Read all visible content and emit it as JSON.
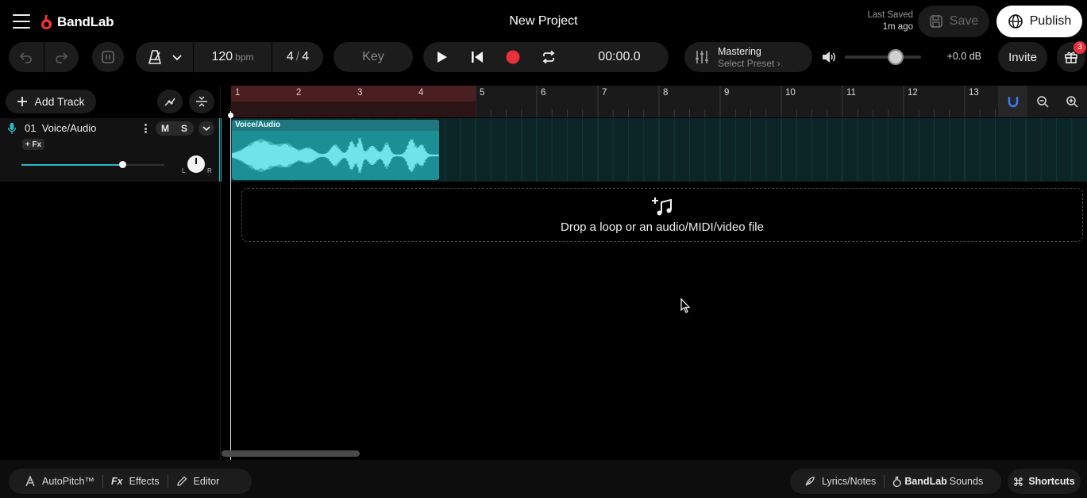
{
  "app": {
    "brand": "BandLab",
    "project_title": "New Project",
    "last_saved_label": "Last Saved",
    "last_saved_ago": "1m ago",
    "save_label": "Save",
    "publish_label": "Publish"
  },
  "toolbar": {
    "bpm_value": "120",
    "bpm_unit": "bpm",
    "time_sig_num": "4",
    "time_sig_den": "4",
    "key_label": "Key",
    "timecode": "00:00.0",
    "mastering_title": "Mastering",
    "mastering_preset": "Select Preset",
    "db_readout": "+0.0 dB",
    "master_volume_fraction": 0.67,
    "invite_label": "Invite",
    "gift_badge_count": "3"
  },
  "tracks_panel": {
    "add_track_label": "Add Track",
    "tracks": [
      {
        "number": "01",
        "name": "Voice/Audio",
        "mute_label": "M",
        "solo_label": "S",
        "fx_label": "+ Fx",
        "pan_left_label": "L",
        "pan_right_label": "R",
        "volume_fraction": 0.71,
        "color": "#2bb8c4"
      }
    ]
  },
  "timeline": {
    "bars": [
      "1",
      "2",
      "3",
      "4",
      "5",
      "6",
      "7",
      "8",
      "9",
      "10",
      "11",
      "12",
      "13"
    ],
    "loop_start_bar": 1,
    "loop_end_bar": 5,
    "clips": [
      {
        "label": "Voice/Audio",
        "track": 1
      }
    ],
    "drop_zone_text": "Drop a loop or an audio/MIDI/video file"
  },
  "bottom_bar": {
    "autopitch_label": "AutoPitch™",
    "effects_prefix": "Fx",
    "effects_label": "Effects",
    "editor_label": "Editor",
    "lyrics_label": "Lyrics/Notes",
    "sounds_brand": "BandLab",
    "sounds_label": "Sounds",
    "shortcuts_label": "Shortcuts"
  },
  "icons": {
    "menu": "hamburger-icon",
    "logo": "bandlab-logo-icon",
    "save": "save-icon",
    "publish": "globe-icon",
    "undo": "undo-icon",
    "redo": "redo-icon",
    "metronome": "metronome-icon",
    "play": "play-icon",
    "rewind": "skip-back-icon",
    "record": "record-icon",
    "loop": "loop-icon",
    "mastering": "sliders-icon",
    "volume": "speaker-icon",
    "gift": "gift-icon"
  },
  "colors": {
    "accent": "#2bb8c4",
    "record": "#e8313d",
    "brand": "#f0343c",
    "loop_region": "#4a1f22"
  }
}
